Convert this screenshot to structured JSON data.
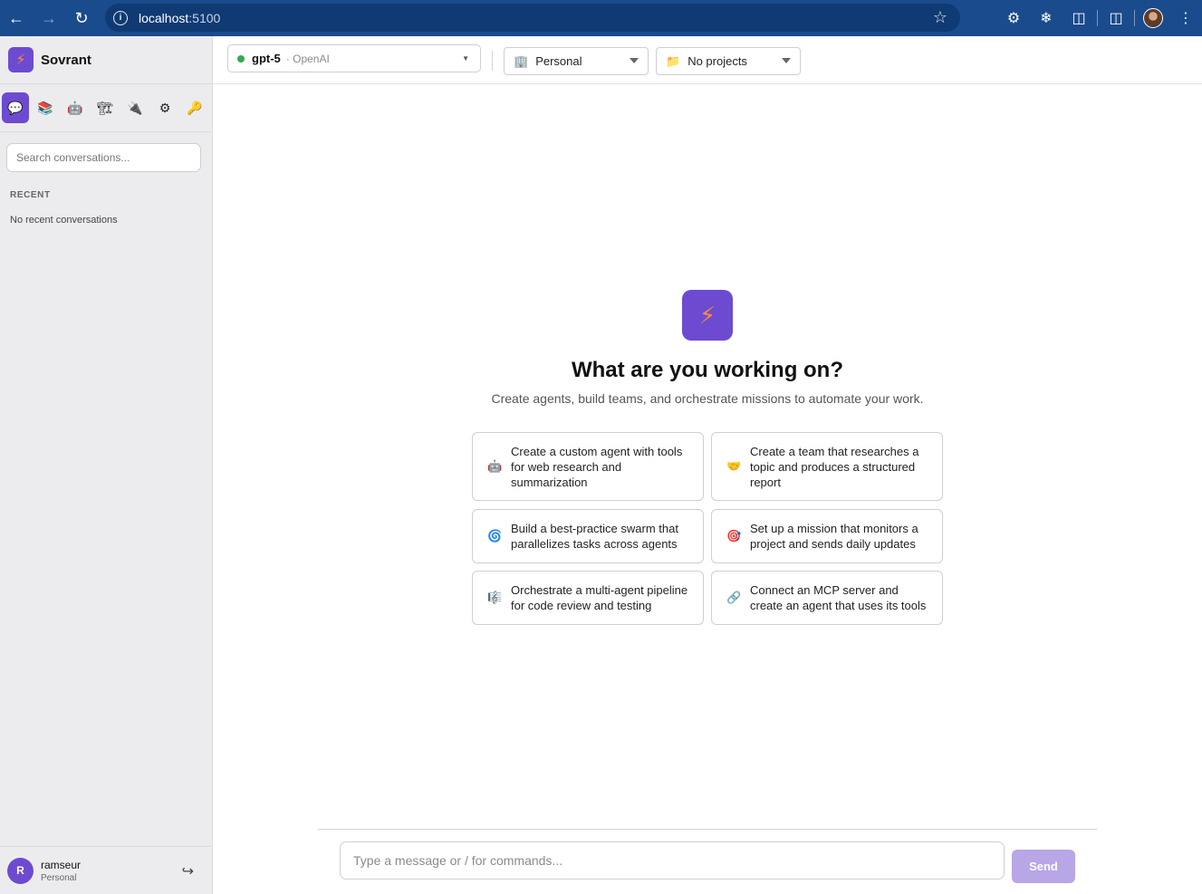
{
  "browser": {
    "url_host": "localhost",
    "url_port": ":5100"
  },
  "sidebar": {
    "brand": "Sovrant",
    "nav_icons": [
      "chat-icon",
      "books-icon",
      "robot-icon",
      "workflow-icon",
      "plug-icon",
      "gear-icon",
      "key-icon"
    ],
    "search_placeholder": "Search conversations...",
    "recent_heading": "RECENT",
    "recent_empty": "No recent conversations",
    "user": {
      "initial": "R",
      "name": "ramseur",
      "workspace": "Personal"
    }
  },
  "topbar": {
    "model_name": "gpt-5",
    "model_provider": "· OpenAI",
    "workspace": "Personal",
    "projects": "No projects"
  },
  "hero": {
    "title": "What are you working on?",
    "subtitle": "Create agents, build teams, and orchestrate missions to automate your work."
  },
  "suggestions": [
    {
      "icon": "robot-icon",
      "text": "Create a custom agent with tools for web research and summarization"
    },
    {
      "icon": "handshake-icon",
      "text": "Create a team that researches a topic and produces a structured report"
    },
    {
      "icon": "swirl-icon",
      "text": "Build a best-practice swarm that parallelizes tasks across agents"
    },
    {
      "icon": "target-icon",
      "text": "Set up a mission that monitors a project and sends daily updates"
    },
    {
      "icon": "music-score-icon",
      "text": "Orchestrate a multi-agent pipeline for code review and testing"
    },
    {
      "icon": "link-icon",
      "text": "Connect an MCP server and create an agent that uses its tools"
    }
  ],
  "composer": {
    "placeholder": "Type a message or / for commands...",
    "send_label": "Send"
  },
  "colors": {
    "accent": "#6d4bd1",
    "chrome": "#1a4b8c",
    "sidebar_bg": "#ececef",
    "send_disabled": "#b8a6e6"
  }
}
